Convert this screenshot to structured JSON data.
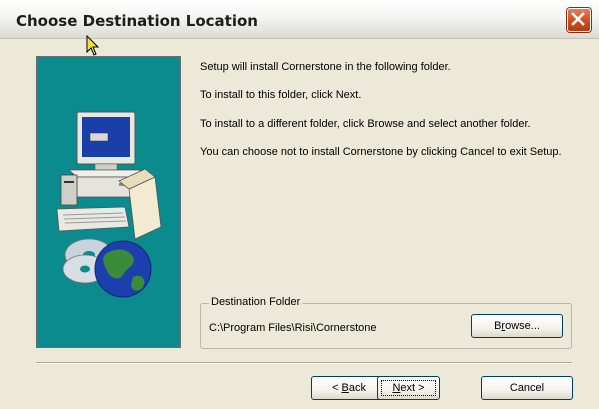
{
  "window": {
    "title": "Choose Destination Location"
  },
  "body": {
    "line1": "Setup will install Cornerstone in the following folder.",
    "line2": "To install to this folder, click Next.",
    "line3": "To install to a different folder, click Browse and select another folder.",
    "line4": "You can choose not to install Cornerstone by clicking Cancel to exit Setup."
  },
  "destination": {
    "legend": "Destination Folder",
    "path": "C:\\Program Files\\Risi\\Cornerstone",
    "browse_label": "Browse...",
    "browse_mnemonic": "r"
  },
  "buttons": {
    "back_label": "< Back",
    "back_mnemonic": "B",
    "next_label": "Next >",
    "next_mnemonic": "N",
    "cancel_label": "Cancel"
  },
  "colors": {
    "panel_background": "#0b8b8e",
    "dialog_background": "#ece9d8",
    "close_button": "#d2501e"
  },
  "icons": {
    "close": "close-icon",
    "cursor": "mouse-cursor-icon",
    "illustration": "computer-with-cd-and-globe"
  }
}
